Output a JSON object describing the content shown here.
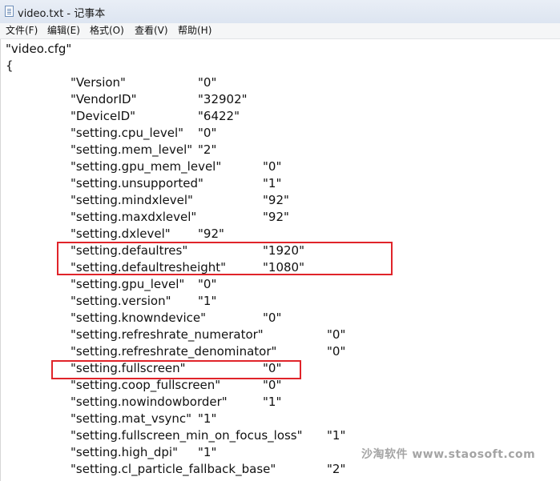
{
  "window": {
    "title": "video.txt - 记事本"
  },
  "menu": {
    "file": "文件(F)",
    "edit": "编辑(E)",
    "format": "格式(O)",
    "view": "查看(V)",
    "help": "帮助(H)"
  },
  "document": {
    "header": "\"video.cfg\"",
    "open_brace": "{",
    "lines": [
      {
        "key": "\"Version\"",
        "value": "\"0\""
      },
      {
        "key": "\"VendorID\"",
        "value": "\"32902\""
      },
      {
        "key": "\"DeviceID\"",
        "value": "\"6422\""
      },
      {
        "key": "\"setting.cpu_level\"",
        "value": "\"0\""
      },
      {
        "key": "\"setting.mem_level\"",
        "value": "\"2\""
      },
      {
        "key": "\"setting.gpu_mem_level\"",
        "value": "\"0\""
      },
      {
        "key": "\"setting.unsupported\"",
        "value": "\"1\""
      },
      {
        "key": "\"setting.mindxlevel\"",
        "value": "\"92\""
      },
      {
        "key": "\"setting.maxdxlevel\"",
        "value": "\"92\""
      },
      {
        "key": "\"setting.dxlevel\"",
        "value": "\"92\""
      },
      {
        "key": "\"setting.defaultres\"",
        "value": "\"1920\""
      },
      {
        "key": "\"setting.defaultresheight\"",
        "value": "\"1080\""
      },
      {
        "key": "\"setting.gpu_level\"",
        "value": "\"0\""
      },
      {
        "key": "\"setting.version\"",
        "value": "\"1\""
      },
      {
        "key": "\"setting.knowndevice\"",
        "value": "\"0\""
      },
      {
        "key": "\"setting.refreshrate_numerator\"",
        "value": "\"0\""
      },
      {
        "key": "\"setting.refreshrate_denominator\"",
        "value": "\"0\""
      },
      {
        "key": "\"setting.fullscreen\"",
        "value": "\"0\""
      },
      {
        "key": "\"setting.coop_fullscreen\"",
        "value": "\"0\""
      },
      {
        "key": "\"setting.nowindowborder\"",
        "value": "\"1\""
      },
      {
        "key": "\"setting.mat_vsync\"",
        "value": "\"1\""
      },
      {
        "key": "\"setting.fullscreen_min_on_focus_loss\"",
        "value": "\"1\""
      },
      {
        "key": "\"setting.high_dpi\"",
        "value": "\"1\""
      },
      {
        "key": "\"setting.cl_particle_fallback_base\"",
        "value": "\"2\""
      }
    ]
  },
  "annotations": {
    "highlight_color": "#e0242a",
    "highlighted_keys": [
      "setting.defaultres",
      "setting.defaultresheight",
      "setting.fullscreen"
    ]
  },
  "watermark": "沙淘软件 www.staosoft.com"
}
